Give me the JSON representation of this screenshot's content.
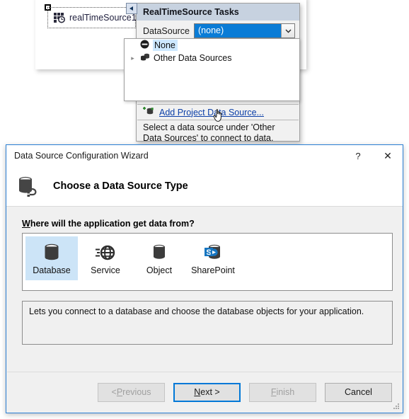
{
  "designer": {
    "component_label": "realTimeSource1",
    "component_icon": "realtime-source-icon"
  },
  "smart_tag": {
    "glyph_icon": "smart-tag-arrow-icon",
    "title": "RealTimeSource Tasks",
    "datasource_label": "DataSource",
    "datasource_value": "(none)",
    "dropdown_arrow_icon": "chevron-down-icon",
    "dropdown_items": [
      {
        "label": "None",
        "icon": "none-circle-icon",
        "selected": true,
        "expandable": false
      },
      {
        "label": "Other Data Sources",
        "icon": "data-sources-icon",
        "selected": false,
        "expandable": true
      }
    ],
    "add_link_icon": "add-data-source-icon",
    "add_link": "Add Project Data Source...",
    "help_text": "Select a data source under 'Other Data Sources' to connect to data."
  },
  "cursor": {
    "icon": "hand-pointer-cursor"
  },
  "wizard": {
    "title": "Data Source Configuration Wizard",
    "help_button": "?",
    "close_button": "✕",
    "header_icon": "database-connection-icon",
    "header_title": "Choose a Data Source Type",
    "prompt_prefix": "W",
    "prompt_rest": "here will the application get data from?",
    "data_source_types": [
      {
        "label": "Database",
        "icon": "database-icon",
        "selected": true
      },
      {
        "label": "Service",
        "icon": "service-globe-icon",
        "selected": false
      },
      {
        "label": "Object",
        "icon": "object-cylinder-icon",
        "selected": false
      },
      {
        "label": "SharePoint",
        "icon": "sharepoint-icon",
        "selected": false
      }
    ],
    "description": "Lets you connect to a database and choose the database objects for your application.",
    "buttons": {
      "previous": "< Previous",
      "previous_accel_pre": "< ",
      "previous_accel": "P",
      "previous_accel_post": "revious",
      "next_accel": "N",
      "next_accel_post": "ext >",
      "finish": "Finish",
      "finish_accel": "F",
      "finish_accel_post": "inish",
      "cancel": "Cancel"
    },
    "resize_grip_icon": "resize-grip-icon"
  },
  "colors": {
    "accent_blue": "#0078d7",
    "selection_blue": "#cce4f7",
    "combo_selected": "#0a7cd6",
    "link_blue": "#0b3fa8",
    "smarttag_title_bg": "#c7d2e0"
  }
}
